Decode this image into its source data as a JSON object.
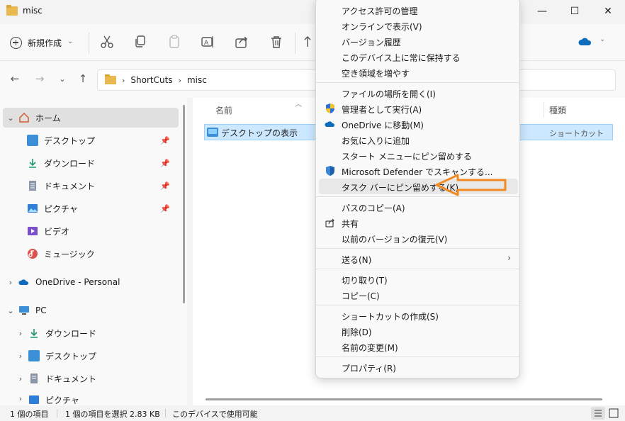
{
  "window": {
    "title": "misc"
  },
  "toolbar": {
    "new_label": "新規作成",
    "new_chevron": "⌄"
  },
  "address": {
    "crumbs": [
      "ShortCuts",
      "misc"
    ]
  },
  "sidebar": {
    "home": "ホーム",
    "quick": [
      "デスクトップ",
      "ダウンロード",
      "ドキュメント",
      "ピクチャ",
      "ビデオ",
      "ミュージック"
    ],
    "onedrive": "OneDrive - Personal",
    "pc": "PC",
    "pc_items": [
      "ダウンロード",
      "デスクトップ",
      "ドキュメント",
      "ピクチャ"
    ]
  },
  "content": {
    "col_name": "名前",
    "col_type": "種類",
    "file": {
      "name": "デスクトップの表示",
      "type": "ショートカット"
    }
  },
  "status": {
    "count": "1 個の項目",
    "selected": "1 個の項目を選択  2.83 KB",
    "availability": "このデバイスで使用可能"
  },
  "context_menu": {
    "items": [
      "アクセス許可の管理",
      "オンラインで表示(V)",
      "バージョン履歴",
      "このデバイス上に常に保持する",
      "空き領域を増やす",
      "ファイルの場所を開く(I)",
      "管理者として実行(A)",
      "OneDrive に移動(M)",
      "お気に入りに追加",
      "スタート メニューにピン留めする",
      "Microsoft Defender でスキャンする...",
      "タスク バーにピン留めする(K)",
      "パスのコピー(A)",
      "共有",
      "以前のバージョンの復元(V)",
      "送る(N)",
      "切り取り(T)",
      "コピー(C)",
      "ショートカットの作成(S)",
      "削除(D)",
      "名前の変更(M)",
      "プロパティ(R)"
    ]
  },
  "colors": {
    "accent": "#0067c0",
    "selection": "#cce8ff",
    "callout": "#f08a24"
  }
}
